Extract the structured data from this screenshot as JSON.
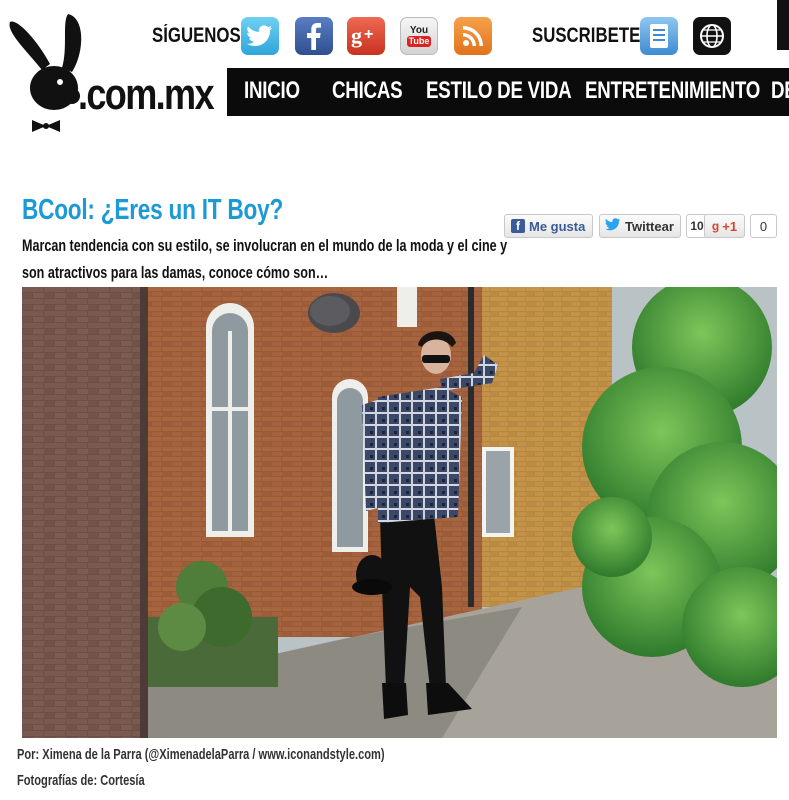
{
  "header": {
    "logo_text": ".com.mx",
    "follow_label": "SÍGUENOS:",
    "subscribe_label": "SUSCRIBETE:",
    "social_icons": [
      "twitter-icon",
      "facebook-icon",
      "google-plus-icon",
      "youtube-icon",
      "rss-icon"
    ],
    "subscribe_icons": [
      "newsletter-icon",
      "globe-icon"
    ],
    "youtube_label_top": "You",
    "youtube_label_bottom": "Tube"
  },
  "nav": {
    "items": [
      "INICIO",
      "CHICAS",
      "ESTILO DE VIDA",
      "ENTRETENIMIENTO",
      "DE"
    ]
  },
  "article": {
    "title": "BCool: ¿Eres un IT Boy?",
    "dek_line1": "Marcan tendencia con su estilo, se involucran en el mundo de la moda y el cine y",
    "dek_line2": "son atractivos para las damas, conoce cómo son…",
    "credit_author": "Por: Ximena de la Parra (@XimenadelaParra / www.iconandstyle.com)",
    "credit_photos": "Fotografías de: Cortesía"
  },
  "share": {
    "like_label": "Me gusta",
    "tweet_label": "Twittear",
    "count_left": "10",
    "gplus_label": "+1",
    "gplus_count": "0"
  },
  "colors": {
    "title": "#1b9ad6",
    "nav_bg": "#0b0b0b",
    "twitter": "#3fb4e6",
    "facebook": "#3b5a9a",
    "google_plus": "#d9432f",
    "rss": "#f08a2c"
  }
}
